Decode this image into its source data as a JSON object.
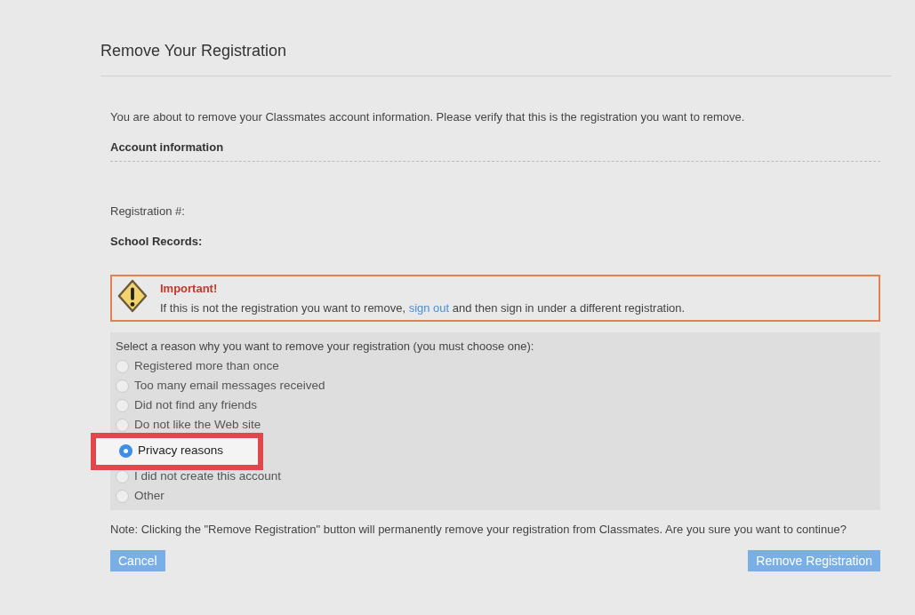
{
  "title": "Remove Your Registration",
  "intro": "You are about to remove your Classmates account information. Please verify that this is the registration you want to remove.",
  "account_heading": "Account information",
  "registration_label": "Registration #:",
  "school_records_label": "School Records:",
  "notice": {
    "title": "Important!",
    "text_before": "If this is not the registration you want to remove,",
    "link": "sign out",
    "text_after": "and then sign in under a different registration."
  },
  "reasons": {
    "prompt": "Select a reason why you want to remove your registration (you must choose one):",
    "options": [
      {
        "label": "Registered more than once",
        "selected": false,
        "highlighted": false
      },
      {
        "label": "Too many email messages received",
        "selected": false,
        "highlighted": false
      },
      {
        "label": "Did not find any friends",
        "selected": false,
        "highlighted": false
      },
      {
        "label": "Do not like the Web site",
        "selected": false,
        "highlighted": false
      },
      {
        "label": "Privacy reasons",
        "selected": true,
        "highlighted": true
      },
      {
        "label": "I did not create this account",
        "selected": false,
        "highlighted": false
      },
      {
        "label": "Other",
        "selected": false,
        "highlighted": false
      }
    ]
  },
  "note": "Note: Clicking the \"Remove Registration\" button will permanently remove your registration from Classmates. Are you sure you want to continue?",
  "buttons": [
    {
      "label": "Cancel"
    },
    {
      "label": "Remove Registration"
    }
  ]
}
